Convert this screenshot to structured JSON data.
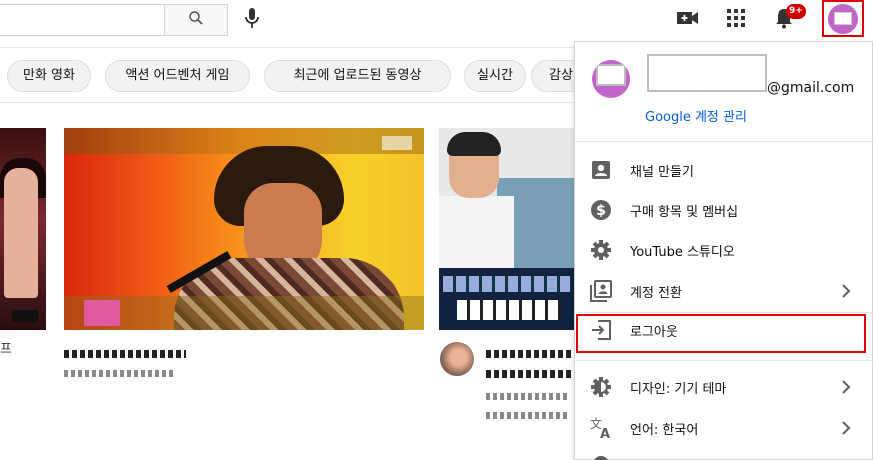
{
  "masthead": {
    "search_placeholder": "",
    "notification_count": "9+"
  },
  "chips": [
    "만화 영화",
    "액션 어드벤처 게임",
    "최근에 업로드된 동영상",
    "실시간",
    "감상"
  ],
  "left_edge_char": "프",
  "account_menu": {
    "email_domain": "@gmail.com",
    "manage_account": "Google 계정 관리",
    "items": [
      {
        "label": "채널 만들기",
        "icon": "account-box-icon",
        "has_arrow": false
      },
      {
        "label": "구매 항목 및 멤버십",
        "icon": "dollar-circle-icon",
        "has_arrow": false
      },
      {
        "label": "YouTube 스튜디오",
        "icon": "gear-icon",
        "has_arrow": false
      },
      {
        "label": "계정 전환",
        "icon": "switch-account-icon",
        "has_arrow": true
      },
      {
        "label": "로그아웃",
        "icon": "sign-out-icon",
        "has_arrow": false
      },
      {
        "label": "디자인: 기기 테마",
        "icon": "theme-icon",
        "has_arrow": true
      },
      {
        "label": "언어: 한국어",
        "icon": "translate-icon",
        "has_arrow": true
      }
    ]
  },
  "colors": {
    "highlight_frame": "#dd0000",
    "avatar": "#c265c8",
    "link": "#065fd4",
    "badge": "#cc0000"
  }
}
